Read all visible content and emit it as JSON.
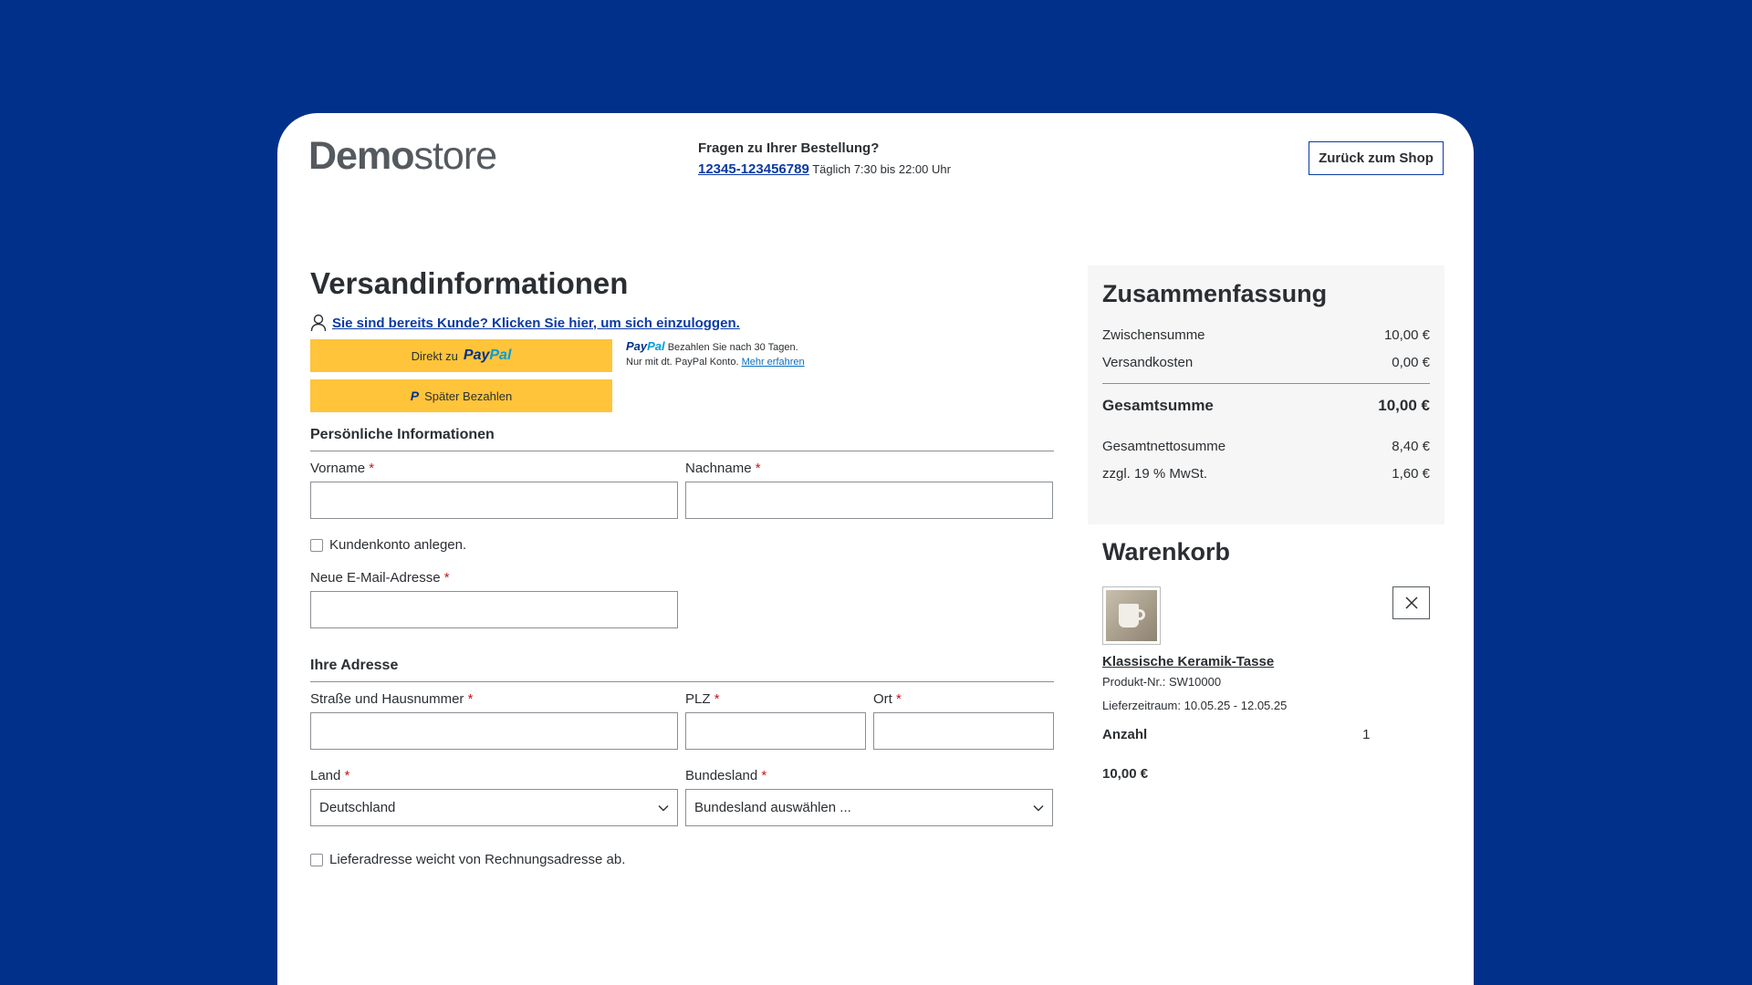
{
  "header": {
    "logo_bold": "Demo",
    "logo_light": "store",
    "contact_title": "Fragen zu Ihrer Bestellung?",
    "contact_phone": "12345-123456789",
    "contact_hours": "Täglich 7:30 bis 22:00 Uhr",
    "back_button": "Zurück zum Shop"
  },
  "main": {
    "title": "Versandinformationen",
    "login_link": "Sie sind bereits Kunde? Klicken Sie hier, um sich einzuloggen.",
    "paypal": {
      "direct_prefix": "Direkt zu",
      "brand_pay": "Pay",
      "brand_pal": "Pal",
      "later_label": "Später Bezahlen",
      "info_line1": "Bezahlen Sie nach 30 Tagen.",
      "info_line2": "Nur mit dt. PayPal Konto.",
      "info_link": "Mehr erfahren"
    },
    "personal": {
      "title": "Persönliche Informationen",
      "firstname_label": "Vorname",
      "lastname_label": "Nachname",
      "create_account_label": "Kundenkonto anlegen.",
      "email_label": "Neue E-Mail-Adresse"
    },
    "address": {
      "title": "Ihre Adresse",
      "street_label": "Straße und Hausnummer",
      "zip_label": "PLZ",
      "city_label": "Ort",
      "country_label": "Land",
      "country_value": "Deutschland",
      "state_label": "Bundesland",
      "state_value": "Bundesland auswählen ...",
      "different_shipping_label": "Lieferadresse weicht von Rechnungsadresse ab."
    },
    "required_mark": "*"
  },
  "summary": {
    "title": "Zusammenfassung",
    "rows": [
      {
        "label": "Zwischensumme",
        "value": "10,00 €"
      },
      {
        "label": "Versandkosten",
        "value": "0,00 €"
      }
    ],
    "total": {
      "label": "Gesamtsumme",
      "value": "10,00 €"
    },
    "net_rows": [
      {
        "label": "Gesamtnettosumme",
        "value": "8,40 €"
      },
      {
        "label": "zzgl. 19 % MwSt.",
        "value": "1,60 €"
      }
    ]
  },
  "cart": {
    "title": "Warenkorb",
    "item": {
      "name": "Klassische Keramik-Tasse",
      "sku": "Produkt-Nr.: SW10000",
      "delivery": "Lieferzeitraum: 10.05.25 - 12.05.25",
      "qty_label": "Anzahl",
      "qty_value": "1",
      "price": "10,00 €",
      "remove_icon": "close-icon"
    }
  },
  "colors": {
    "background": "#00308a",
    "link": "#0b3aa3",
    "paypal_yellow": "#ffc439",
    "required": "#c3171b"
  }
}
